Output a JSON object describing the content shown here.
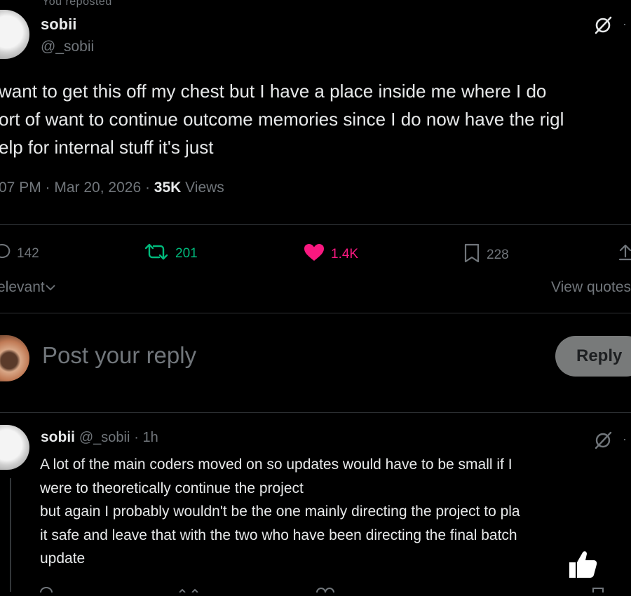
{
  "top_strip": {
    "text": "You reposted"
  },
  "post": {
    "author": {
      "display_name": "sobii",
      "handle": "@_sobii"
    },
    "text_lines": [
      "want to get this off my chest but I have a place inside me where I do",
      "ort of want to continue outcome memories since I do now have the rigl",
      "elp for internal stuff   it's just"
    ],
    "meta": {
      "time": "07 PM",
      "date": "Mar 20, 2026",
      "separator": " · ",
      "views_count": "35K",
      "views_label": "Views"
    },
    "actions": {
      "replies": "142",
      "reposts": "201",
      "likes": "1.4K",
      "bookmarks": "228"
    },
    "colors": {
      "repost": "#00ba7c",
      "like": "#f91880",
      "muted": "#71767b",
      "text": "#e7e9ea",
      "background": "#000000"
    }
  },
  "sort": {
    "label": "elevant"
  },
  "view_quotes": {
    "label": "View quotes"
  },
  "composer": {
    "placeholder": "Post your reply",
    "button_label": "Reply"
  },
  "reply": {
    "display_name": "sobii",
    "handle": "@_sobii",
    "time": "· 1h",
    "text_lines": [
      "A lot of the main coders moved on so updates would have to be small if I",
      "were to theoretically continue the project",
      "but again I probably wouldn't be the one mainly directing the project to pla",
      "it safe and leave that with the two who have been directing the final batch",
      "update"
    ]
  },
  "icons": {
    "grok": "grok-slash-icon",
    "reply": "comment-bubble-icon",
    "repost": "repost-arrows-icon",
    "like": "heart-filled-icon",
    "bookmark": "bookmark-icon",
    "share": "share-upload-icon",
    "chevron": "chevron-down-icon",
    "overlay": "thumbs-up-icon"
  }
}
